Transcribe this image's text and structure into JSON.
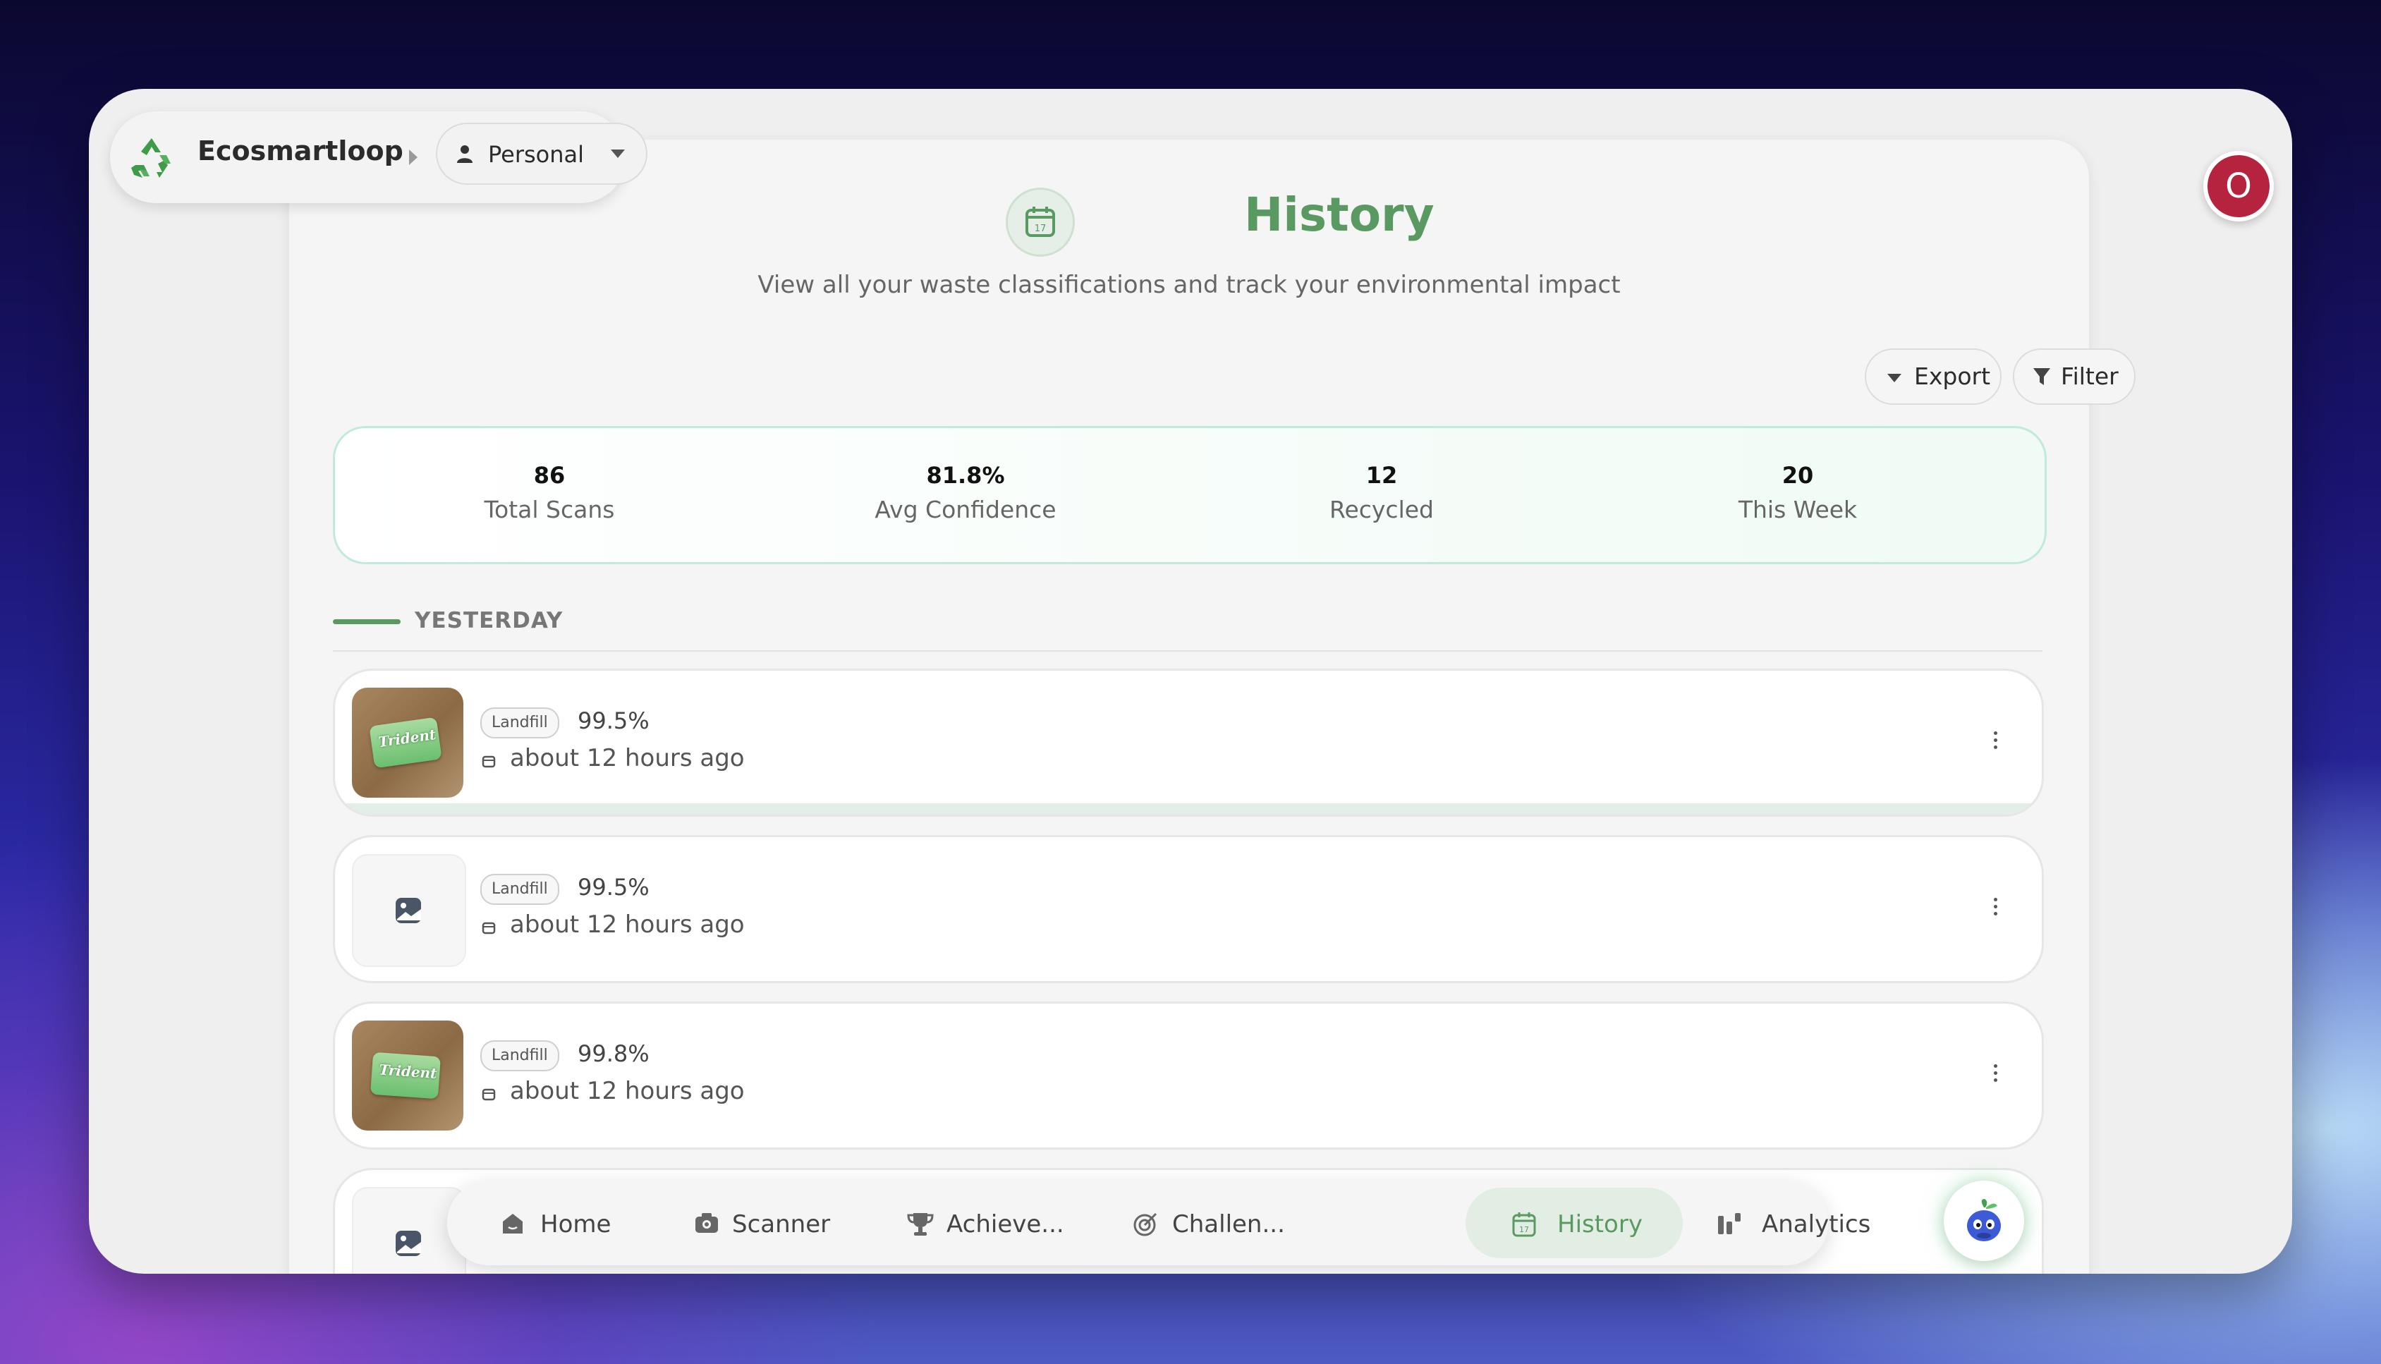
{
  "app": {
    "name": "Ecosmartloop",
    "workspace": "Personal",
    "avatar_initial": "O"
  },
  "header": {
    "title": "History",
    "subtitle": "View all your waste classifications and track your environmental impact",
    "icon": "calendar-icon"
  },
  "toolbar": {
    "export_label": "Export",
    "filter_label": "Filter"
  },
  "stats": [
    {
      "value": "86",
      "label": "Total Scans"
    },
    {
      "value": "81.8%",
      "label": "Avg Confidence"
    },
    {
      "value": "12",
      "label": "Recycled"
    },
    {
      "value": "20",
      "label": "This Week"
    }
  ],
  "section": {
    "title": "YESTERDAY"
  },
  "items": [
    {
      "category": "Landfill",
      "confidence": "99.5%",
      "time": "about 12 hours ago",
      "thumbnail": "photo"
    },
    {
      "category": "Landfill",
      "confidence": "99.5%",
      "time": "about 12 hours ago",
      "thumbnail": "placeholder"
    },
    {
      "category": "Landfill",
      "confidence": "99.8%",
      "time": "about 12 hours ago",
      "thumbnail": "photo"
    },
    {
      "category": "",
      "confidence": "",
      "time": "",
      "thumbnail": "placeholder"
    }
  ],
  "thumbnail_text": "Trident",
  "nav": [
    {
      "label": "Home",
      "icon": "home-icon"
    },
    {
      "label": "Scanner",
      "icon": "camera-icon"
    },
    {
      "label": "Achieve...",
      "icon": "trophy-icon"
    },
    {
      "label": "Challen...",
      "icon": "target-icon"
    },
    {
      "label": "History",
      "icon": "calendar-icon",
      "active": true
    },
    {
      "label": "Analytics",
      "icon": "chart-icon"
    }
  ],
  "colors": {
    "accent_green": "#5a9a62",
    "avatar": "#b5233f",
    "stats_border": "#bfeadd"
  }
}
